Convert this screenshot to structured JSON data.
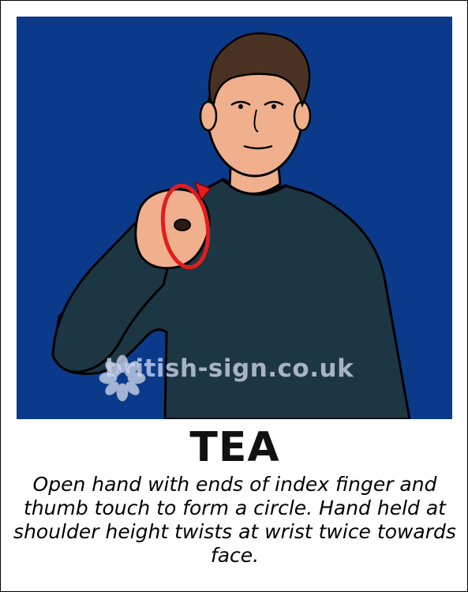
{
  "sign": {
    "word": "TEA",
    "description": "Open hand with ends of index finger and thumb touch to form a circle. Hand held at shoulder height twists at wrist twice towards face."
  },
  "watermark": {
    "text": "british-sign.co.uk",
    "icon": "hands-circle-logo-icon"
  },
  "colors": {
    "background": "#0b3a8a",
    "shirt": "#1d3644",
    "skin": "#f0b08e",
    "hair": "#4a3222",
    "arrow": "#e21d1d"
  }
}
